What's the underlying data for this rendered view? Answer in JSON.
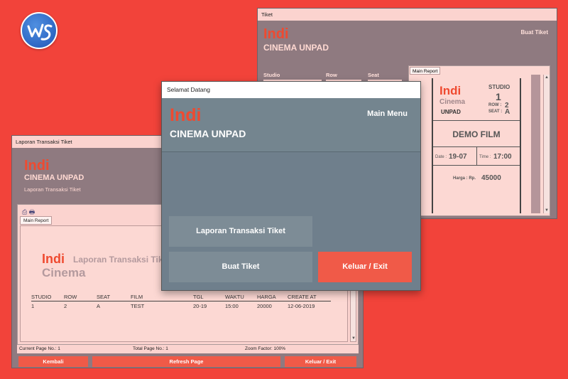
{
  "laporan_window": {
    "title": "Laporan Transaksi Tiket",
    "brand": "Indi",
    "subtitle": "CINEMA UNPAD",
    "caption": "Laporan Transaksi Tiket",
    "tab": "Main Report",
    "report": {
      "brand": "Indi",
      "cinema": "Cinema",
      "title": "Laporan Transaksi Tiket",
      "headers": [
        "STUDIO",
        "ROW",
        "SEAT",
        "FILM",
        "TGL",
        "WAKTU",
        "HARGA",
        "CREATE AT"
      ],
      "rows": [
        [
          "1",
          "2",
          "A",
          "TEST",
          "20-19",
          "15:00",
          "20000",
          "12-06-2019"
        ]
      ]
    },
    "status": {
      "current_page": "Current Page No.: 1",
      "total_page": "Total Page No.: 1",
      "zoom": "Zoom Factor: 100%"
    },
    "buttons": {
      "kembali": "Kembali",
      "refresh": "Refresh Page",
      "exit": "Keluar / Exit"
    }
  },
  "tiket_window": {
    "title": "Tiket",
    "brand": "Indi",
    "subtitle": "CINEMA UNPAD",
    "action": "Buat Tiket",
    "labels": {
      "studio": "Studio",
      "row": "Row",
      "seat": "Seat"
    },
    "tab": "Main Report",
    "ticket": {
      "brand": "Indi",
      "cinema": "Cinema",
      "unpad": "UNPAD",
      "studio_label": "STUDIO",
      "studio": "1",
      "row_label": "ROW :",
      "row": "2",
      "seat_label": "SEAT :",
      "seat": "A",
      "film": "DEMO FILM",
      "date_label": "Date :",
      "date": "19-07",
      "time_label": "Time :",
      "time": "17:00",
      "price_label": "Harga : Rp.",
      "price": "45000"
    }
  },
  "main_window": {
    "title": "Selamat Datang",
    "brand": "Indi",
    "subtitle": "CINEMA UNPAD",
    "menu_label": "Main Menu",
    "buttons": {
      "laporan": "Laporan Transaksi Tiket",
      "buat_tiket": "Buat Tiket",
      "exit": "Keluar / Exit"
    }
  },
  "colors": {
    "background": "#f2433a",
    "accent": "#ef4a30",
    "button_exit": "#f05a48"
  }
}
